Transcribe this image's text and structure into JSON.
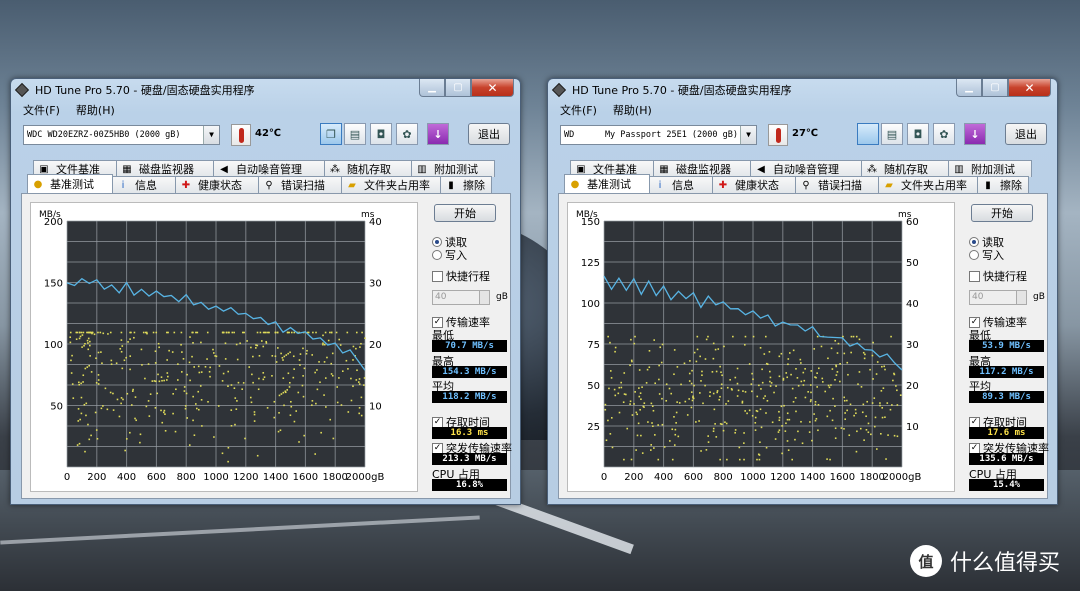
{
  "background": {
    "watermark_text": "什么值得买",
    "watermark_icon": "值"
  },
  "windows": [
    {
      "title": "HD Tune Pro 5.70 - 硬盘/固态硬盘实用程序",
      "menu": [
        "文件(F)",
        "帮助(H)"
      ],
      "drive": "WDC WD20EZRZ-00Z5HB0 (2000 gB)",
      "temperature": "42℃",
      "exit_label": "退出",
      "tabs_row1": [
        "文件基准",
        "磁盘监视器",
        "自动噪音管理",
        "随机存取",
        "附加测试"
      ],
      "tabs_row2": [
        "基准测试",
        "信息",
        "健康状态",
        "错误扫描",
        "文件夹占用率",
        "擦除"
      ],
      "start_label": "开始",
      "read_label": "读取",
      "write_label": "写入",
      "shortstroke_label": "快捷行程",
      "shortstroke_value": "40",
      "shortstroke_unit": "gB",
      "transfer_label": "传输速率",
      "min_label": "最低",
      "min_value": "70.7 MB/s",
      "max_label": "最高",
      "max_value": "154.3 MB/s",
      "avg_label": "平均",
      "avg_value": "118.2 MB/s",
      "access_label": "存取时间",
      "access_value": "16.3 ms",
      "burst_label": "突发传输速率",
      "burst_value": "213.3 MB/s",
      "cpu_label": "CPU 占用",
      "cpu_value": "16.8%",
      "chart_data": {
        "type": "line",
        "title": "",
        "xlabel": "gB",
        "ylabel": "MB/s",
        "y2label": "ms",
        "xlim": [
          0,
          2000
        ],
        "ylim": [
          0,
          200
        ],
        "y2lim": [
          0,
          40
        ],
        "x_ticks": [
          "0",
          "200",
          "400",
          "600",
          "800",
          "1000",
          "1200",
          "1400",
          "1600",
          "1800",
          "2000gB"
        ],
        "y_ticks": [
          "200",
          "150",
          "100",
          "50"
        ],
        "y2_ticks": [
          "40",
          "30",
          "20",
          "10"
        ],
        "series": [
          {
            "name": "传输速率",
            "color": "#58b4e4",
            "x": [
              0,
              50,
              100,
              150,
              200,
              250,
              300,
              350,
              400,
              450,
              500,
              550,
              600,
              650,
              700,
              750,
              800,
              850,
              900,
              950,
              1000,
              1050,
              1100,
              1150,
              1200,
              1250,
              1300,
              1350,
              1400,
              1450,
              1500,
              1550,
              1600,
              1650,
              1700,
              1750,
              1800,
              1850,
              1900,
              1950,
              2000
            ],
            "values": [
              150,
              146,
              153,
              148,
              152,
              145,
              150,
              143,
              148,
              140,
              146,
              138,
              143,
              137,
              141,
              134,
              139,
              132,
              135,
              129,
              132,
              126,
              128,
              123,
              125,
              119,
              121,
              114,
              117,
              111,
              113,
              107,
              109,
              103,
              104,
              98,
              99,
              92,
              94,
              87,
              80
            ]
          }
        ],
        "access_time_ms": {
          "x_range": [
            0,
            2000
          ],
          "y_range": [
            1,
            22
          ],
          "mean": 16.3,
          "color": "#e0dc5a"
        }
      }
    },
    {
      "title": "HD Tune Pro 5.70 - 硬盘/固态硬盘实用程序",
      "menu": [
        "文件(F)",
        "帮助(H)"
      ],
      "drive": "WD      My Passport 25E1 (2000 gB)",
      "temperature": "27℃",
      "exit_label": "退出",
      "tabs_row1": [
        "文件基准",
        "磁盘监视器",
        "自动噪音管理",
        "随机存取",
        "附加测试"
      ],
      "tabs_row2": [
        "基准测试",
        "信息",
        "健康状态",
        "错误扫描",
        "文件夹占用率",
        "擦除"
      ],
      "start_label": "开始",
      "read_label": "读取",
      "write_label": "写入",
      "shortstroke_label": "快捷行程",
      "shortstroke_value": "40",
      "shortstroke_unit": "gB",
      "transfer_label": "传输速率",
      "min_label": "最低",
      "min_value": "53.9 MB/s",
      "max_label": "最高",
      "max_value": "117.2 MB/s",
      "avg_label": "平均",
      "avg_value": "89.3 MB/s",
      "access_label": "存取时间",
      "access_value": "17.6 ms",
      "burst_label": "突发传输速率",
      "burst_value": "135.6 MB/s",
      "cpu_label": "CPU 占用",
      "cpu_value": "15.4%",
      "chart_data": {
        "type": "line",
        "title": "",
        "xlabel": "gB",
        "ylabel": "MB/s",
        "y2label": "ms",
        "xlim": [
          0,
          2000
        ],
        "ylim": [
          0,
          150
        ],
        "y2lim": [
          0,
          60
        ],
        "x_ticks": [
          "0",
          "200",
          "400",
          "600",
          "800",
          "1000",
          "1200",
          "1400",
          "1600",
          "1800",
          "2000gB"
        ],
        "y_ticks": [
          "150",
          "125",
          "100",
          "75",
          "50",
          "25"
        ],
        "y2_ticks": [
          "60",
          "50",
          "40",
          "30",
          "20",
          "10"
        ],
        "series": [
          {
            "name": "传输速率",
            "color": "#58b4e4",
            "x": [
              0,
              50,
              100,
              150,
              200,
              250,
              300,
              350,
              400,
              450,
              500,
              550,
              600,
              650,
              700,
              750,
              800,
              850,
              900,
              950,
              1000,
              1050,
              1100,
              1150,
              1200,
              1250,
              1300,
              1350,
              1400,
              1450,
              1500,
              1550,
              1600,
              1650,
              1700,
              1750,
              1800,
              1850,
              1900,
              1950,
              2000
            ],
            "values": [
              115,
              110,
              116,
              109,
              113,
              107,
              112,
              104,
              109,
              103,
              107,
              101,
              105,
              99,
              103,
              97,
              100,
              95,
              98,
              92,
              95,
              90,
              92,
              87,
              90,
              85,
              87,
              82,
              84,
              80,
              81,
              77,
              78,
              74,
              75,
              71,
              72,
              68,
              68,
              65,
              60
            ]
          }
        ],
        "access_time_ms": {
          "x_range": [
            0,
            2000
          ],
          "y_range": [
            2,
            32
          ],
          "mean": 17.6,
          "color": "#e0dc5a"
        }
      }
    }
  ]
}
